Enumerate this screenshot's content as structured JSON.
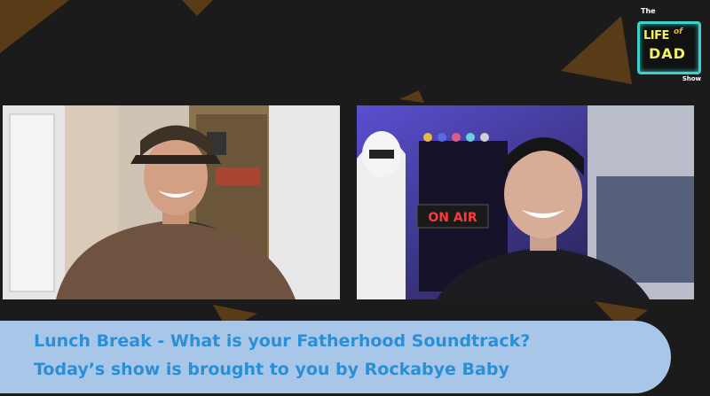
{
  "logo": {
    "the": "The",
    "life": "LIFE",
    "of": "of",
    "dad": "DAD",
    "show": "Show"
  },
  "participants": [
    {
      "name_icon": "person-video-left"
    },
    {
      "name_icon": "person-video-right",
      "sign_text": "ON AIR"
    }
  ],
  "banner": {
    "line1": "Lunch Break - What is your Fatherhood Soundtrack?",
    "line2": "Today’s show is brought to you by Rockabye Baby"
  },
  "colors": {
    "background": "#1b1b1b",
    "triangle": "#5a3b17",
    "banner_bg": "#a8c6e8",
    "banner_text": "#2a8fd7",
    "logo_border": "#3fd0c9",
    "logo_text": "#f2f06a"
  }
}
